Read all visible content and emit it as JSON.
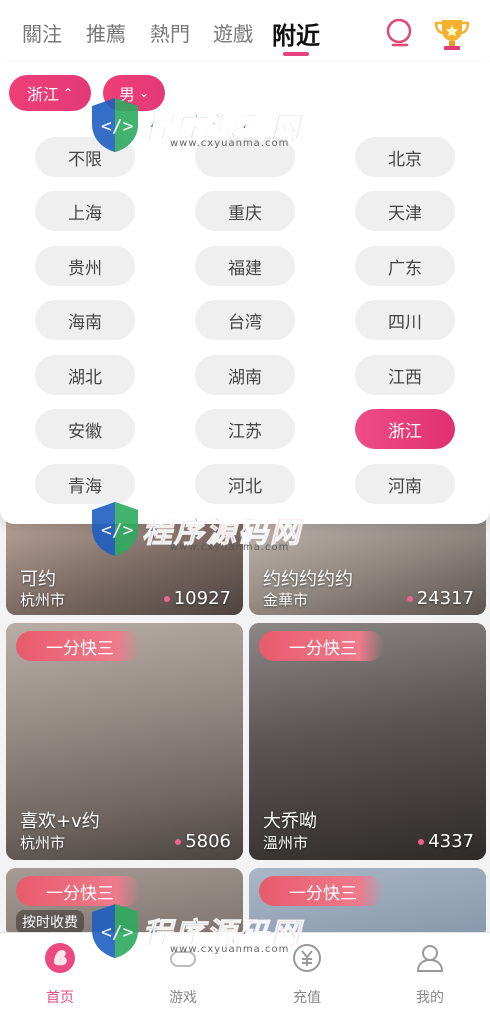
{
  "header": {
    "tabs": [
      "關注",
      "推薦",
      "熱門",
      "遊戲",
      "附近"
    ],
    "active_tab": "附近"
  },
  "filters": {
    "province": "浙江",
    "gender": "男"
  },
  "provinces": [
    "不限",
    "",
    "北京",
    "上海",
    "重庆",
    "天津",
    "贵州",
    "福建",
    "广东",
    "海南",
    "台湾",
    "四川",
    "湖北",
    "湖南",
    "江西",
    "安徽",
    "江苏",
    "浙江",
    "青海",
    "河北",
    "河南"
  ],
  "selected_province": "浙江",
  "cards": [
    {
      "tag": "",
      "title": "可约",
      "city": "杭州市",
      "count": "10927"
    },
    {
      "tag": "",
      "title": "约约约约约",
      "city": "金華市",
      "count": "24317"
    },
    {
      "tag": "一分快三",
      "title": "喜欢+v约",
      "city": "杭州市",
      "count": "5806"
    },
    {
      "tag": "一分快三",
      "title": "大乔呦",
      "city": "溫州市",
      "count": "4337"
    },
    {
      "tag": "一分快三",
      "title": "",
      "city": "",
      "count": "",
      "badge": "按时收费"
    },
    {
      "tag": "一分快三",
      "title": "",
      "city": "",
      "count": ""
    }
  ],
  "bottom_nav": [
    {
      "label": "首页",
      "icon": "home-icon"
    },
    {
      "label": "游戏",
      "icon": "game-icon"
    },
    {
      "label": "充值",
      "icon": "recharge-icon"
    },
    {
      "label": "我的",
      "icon": "profile-icon"
    }
  ],
  "watermark": {
    "text_blue": "程序",
    "text_pink": "源码网",
    "url": "www.cxyuanma.com"
  },
  "colors": {
    "accent": "#e6427b",
    "chip": "#ef3e78"
  }
}
